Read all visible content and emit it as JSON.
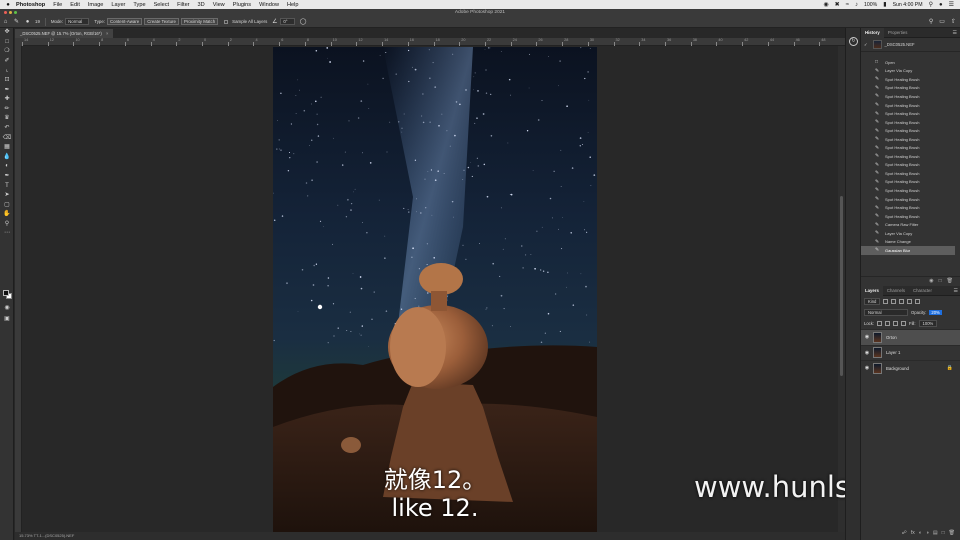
{
  "menubar": {
    "apple": "",
    "items": [
      "Photoshop",
      "File",
      "Edit",
      "Image",
      "Layer",
      "Type",
      "Select",
      "Filter",
      "3D",
      "View",
      "Plugins",
      "Window",
      "Help"
    ],
    "battery": "100%",
    "clock": "Sun 4:00 PM"
  },
  "window": {
    "title": "Adobe Photoshop 2021"
  },
  "options_bar": {
    "brush_size": "19",
    "mode_label": "Mode:",
    "mode_value": "Normal",
    "type_label": "Type:",
    "type_buttons": [
      "Content-Aware",
      "Create Texture",
      "Proximity Match"
    ],
    "sample_all_layers": "Sample All Layers",
    "angle": "0°"
  },
  "document": {
    "tab": "_DSC0525.NEF @ 15.7% (Orton, RGB/16*)",
    "close": "×",
    "status": "15.73%     TT-1...(DSC0525).NEF"
  },
  "ruler": {
    "labels": [
      "14",
      "12",
      "10",
      "8",
      "6",
      "4",
      "2",
      "0",
      "2",
      "4",
      "6",
      "8",
      "10",
      "12",
      "14",
      "16",
      "18",
      "20",
      "22",
      "24",
      "26",
      "28",
      "30",
      "32",
      "34",
      "36",
      "38",
      "40",
      "42",
      "44",
      "46",
      "48"
    ]
  },
  "subtitles": {
    "chinese": "就像12。",
    "english": "like 12."
  },
  "watermark": "www.hunls.com",
  "history_panel": {
    "tabs": [
      "History",
      "Properties"
    ],
    "snapshot": "_DSC0525.NEF",
    "items": [
      "Open",
      "Layer Via Copy",
      "Spot Healing Brush",
      "Spot Healing Brush",
      "Spot Healing Brush",
      "Spot Healing Brush",
      "Spot Healing Brush",
      "Spot Healing Brush",
      "Spot Healing Brush",
      "Spot Healing Brush",
      "Spot Healing Brush",
      "Spot Healing Brush",
      "Spot Healing Brush",
      "Spot Healing Brush",
      "Spot Healing Brush",
      "Spot Healing Brush",
      "Spot Healing Brush",
      "Spot Healing Brush",
      "Spot Healing Brush",
      "Camera Raw Filter",
      "Layer Via Copy",
      "Name Change",
      "Gaussian Blur"
    ],
    "active_index": 22
  },
  "layers_panel": {
    "tabs": [
      "Layers",
      "Channels",
      "Character"
    ],
    "kind": "Kind",
    "blend_mode": "Normal",
    "opacity_label": "Opacity:",
    "opacity_value": "20%",
    "lock_label": "Lock:",
    "fill_label": "Fill:",
    "fill_value": "100%",
    "layers": [
      {
        "name": "Orton",
        "active": true
      },
      {
        "name": "Layer 1",
        "active": false
      },
      {
        "name": "Background",
        "active": false,
        "locked": true
      }
    ]
  },
  "colors": {
    "foreground": "#111111",
    "background": "#ffffff",
    "ui_bg": "#282828",
    "panel": "#333333"
  }
}
